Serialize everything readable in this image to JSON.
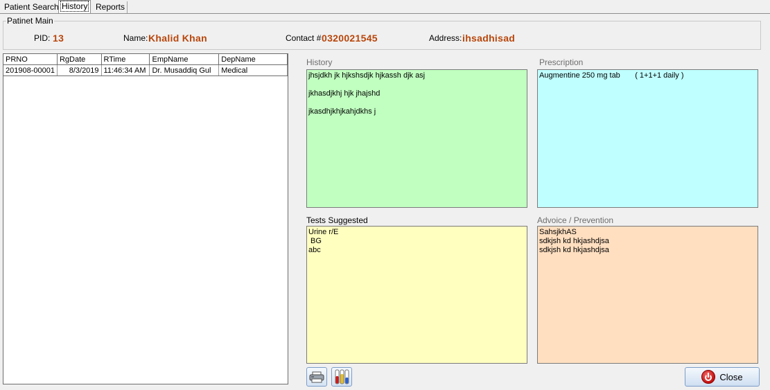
{
  "tabs": [
    {
      "label": "Patient Search"
    },
    {
      "label": "History"
    },
    {
      "label": "Reports"
    }
  ],
  "patient": {
    "group_title": "Patinet Main",
    "pid_label": "PID:",
    "pid": "13",
    "name_label": "Name:",
    "name": "Khalid Khan",
    "contact_label": "Contact #",
    "contact": "0320021545",
    "address_label": "Address:",
    "address": "ihsadhisad"
  },
  "grid": {
    "columns": [
      "PRNO",
      "RgDate",
      "RTime",
      "EmpName",
      "DepName"
    ],
    "rows": [
      {
        "prno": "201908-00001",
        "rgdate": "8/3/2019",
        "rtime": "11:46:34 AM",
        "empname": "Dr. Musaddiq Gul",
        "depname": "Medical"
      }
    ]
  },
  "history": {
    "label": "History",
    "text": "jhsjdkh jk hjkshsdjk hjkassh djk asj\n\njkhasdjkhj hjk jhajshd\n\njkasdhjkhjkahjdkhs j"
  },
  "prescription": {
    "label": "Prescription",
    "text": "Augmentine 250 mg tab       ( 1+1+1 daily )"
  },
  "tests": {
    "label": "Tests Suggested",
    "text": "Urine r/E\n BG\nabc"
  },
  "advice": {
    "label": "Advoice / Prevention",
    "text": "SahsjkhAS\nsdkjsh kd hkjashdjsa\nsdkjsh kd hkjashdjsa"
  },
  "buttons": {
    "print_icon": "printer-icon",
    "lab_icon": "test-tubes-icon",
    "close_label": "Close",
    "close_icon": "power-icon"
  },
  "colors": {
    "value_text": "#b8460b",
    "history_bg": "#c0ffc0",
    "prescription_bg": "#c0ffff",
    "tests_bg": "#ffffc0",
    "advice_bg": "#ffdfc0"
  }
}
